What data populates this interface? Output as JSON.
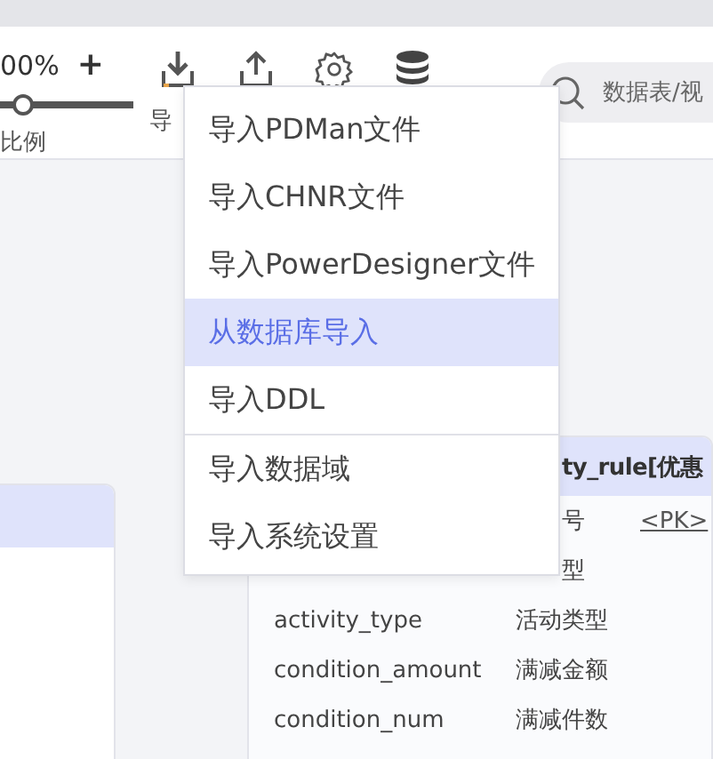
{
  "zoom": {
    "value": "00%",
    "plus": "+",
    "level": 0.17,
    "label": "比例"
  },
  "tools": [
    {
      "kind": "import",
      "label": "导"
    },
    {
      "kind": "export"
    },
    {
      "kind": "settings"
    },
    {
      "kind": "database"
    }
  ],
  "search": {
    "placeholder": "数据表/视"
  },
  "import_menu": [
    {
      "label": "导入PDMan文件",
      "selected": false,
      "divider_before": false
    },
    {
      "label": "导入CHNR文件",
      "selected": false,
      "divider_before": false
    },
    {
      "label": "导入PowerDesigner文件",
      "selected": false,
      "divider_before": false
    },
    {
      "label": "从数据库导入",
      "selected": true,
      "divider_before": false
    },
    {
      "label": "导入DDL",
      "selected": false,
      "divider_before": false
    },
    {
      "label": "导入数据域",
      "selected": false,
      "divider_before": true
    },
    {
      "label": "导入系统设置",
      "selected": false,
      "divider_before": false
    }
  ],
  "entity": {
    "title": "ty_rule[优惠",
    "rows": [
      {
        "comment": "号",
        "key": "<PK>"
      },
      {
        "comment": "型"
      },
      {
        "name": "activity_type",
        "comment": "活动类型"
      },
      {
        "name": "condition_amount",
        "comment": "满减金额"
      },
      {
        "name": "condition_num",
        "comment": "满减件数"
      }
    ]
  }
}
